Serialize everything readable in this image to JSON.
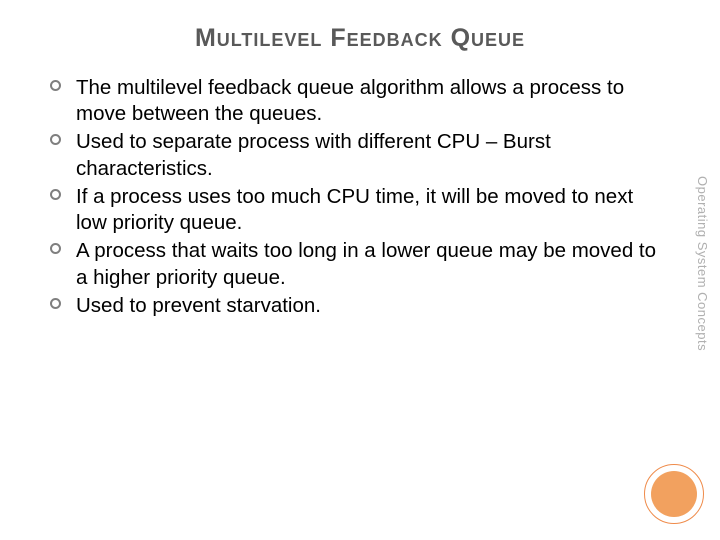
{
  "slide": {
    "title": "Multilevel  Feedback Queue",
    "bullets": [
      "The multilevel feedback queue algorithm allows a process to move between the queues.",
      "Used to separate process with different CPU – Burst characteristics.",
      "If a process uses too much CPU time, it will be moved to next low priority queue.",
      "A process that waits too long in a lower queue may be moved to a higher priority queue.",
      "Used to prevent starvation."
    ],
    "side_label": "Operating System Concepts"
  }
}
